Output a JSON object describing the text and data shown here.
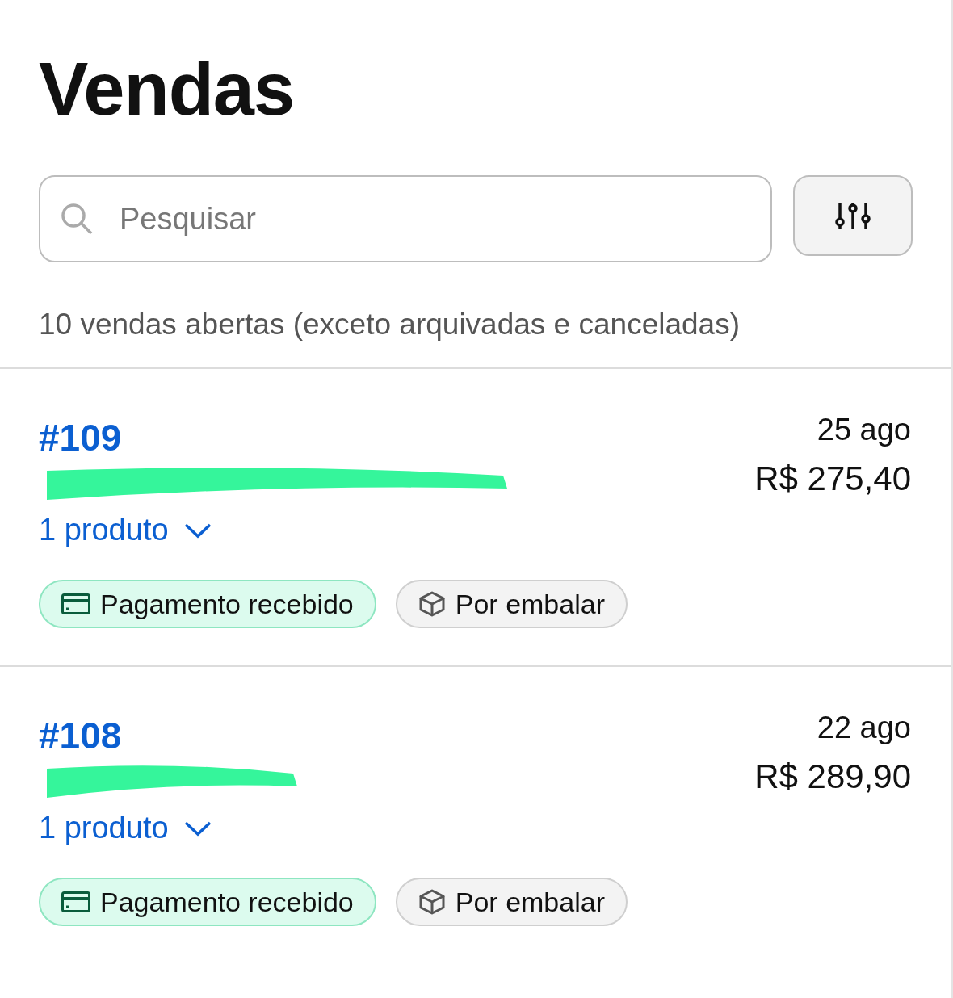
{
  "title": "Vendas",
  "search": {
    "placeholder": "Pesquisar"
  },
  "summary": "10 vendas abertas (exceto arquivadas e canceladas)",
  "orders": [
    {
      "number": "#109",
      "date": "25 ago",
      "total": "R$ 275,40",
      "products": "1 produto",
      "badges": [
        {
          "kind": "payment",
          "label": "Pagamento recebido"
        },
        {
          "kind": "packing",
          "label": "Por embalar"
        }
      ]
    },
    {
      "number": "#108",
      "date": "22 ago",
      "total": "R$ 289,90",
      "products": "1 produto",
      "badges": [
        {
          "kind": "payment",
          "label": "Pagamento recebido"
        },
        {
          "kind": "packing",
          "label": "Por embalar"
        }
      ]
    }
  ]
}
